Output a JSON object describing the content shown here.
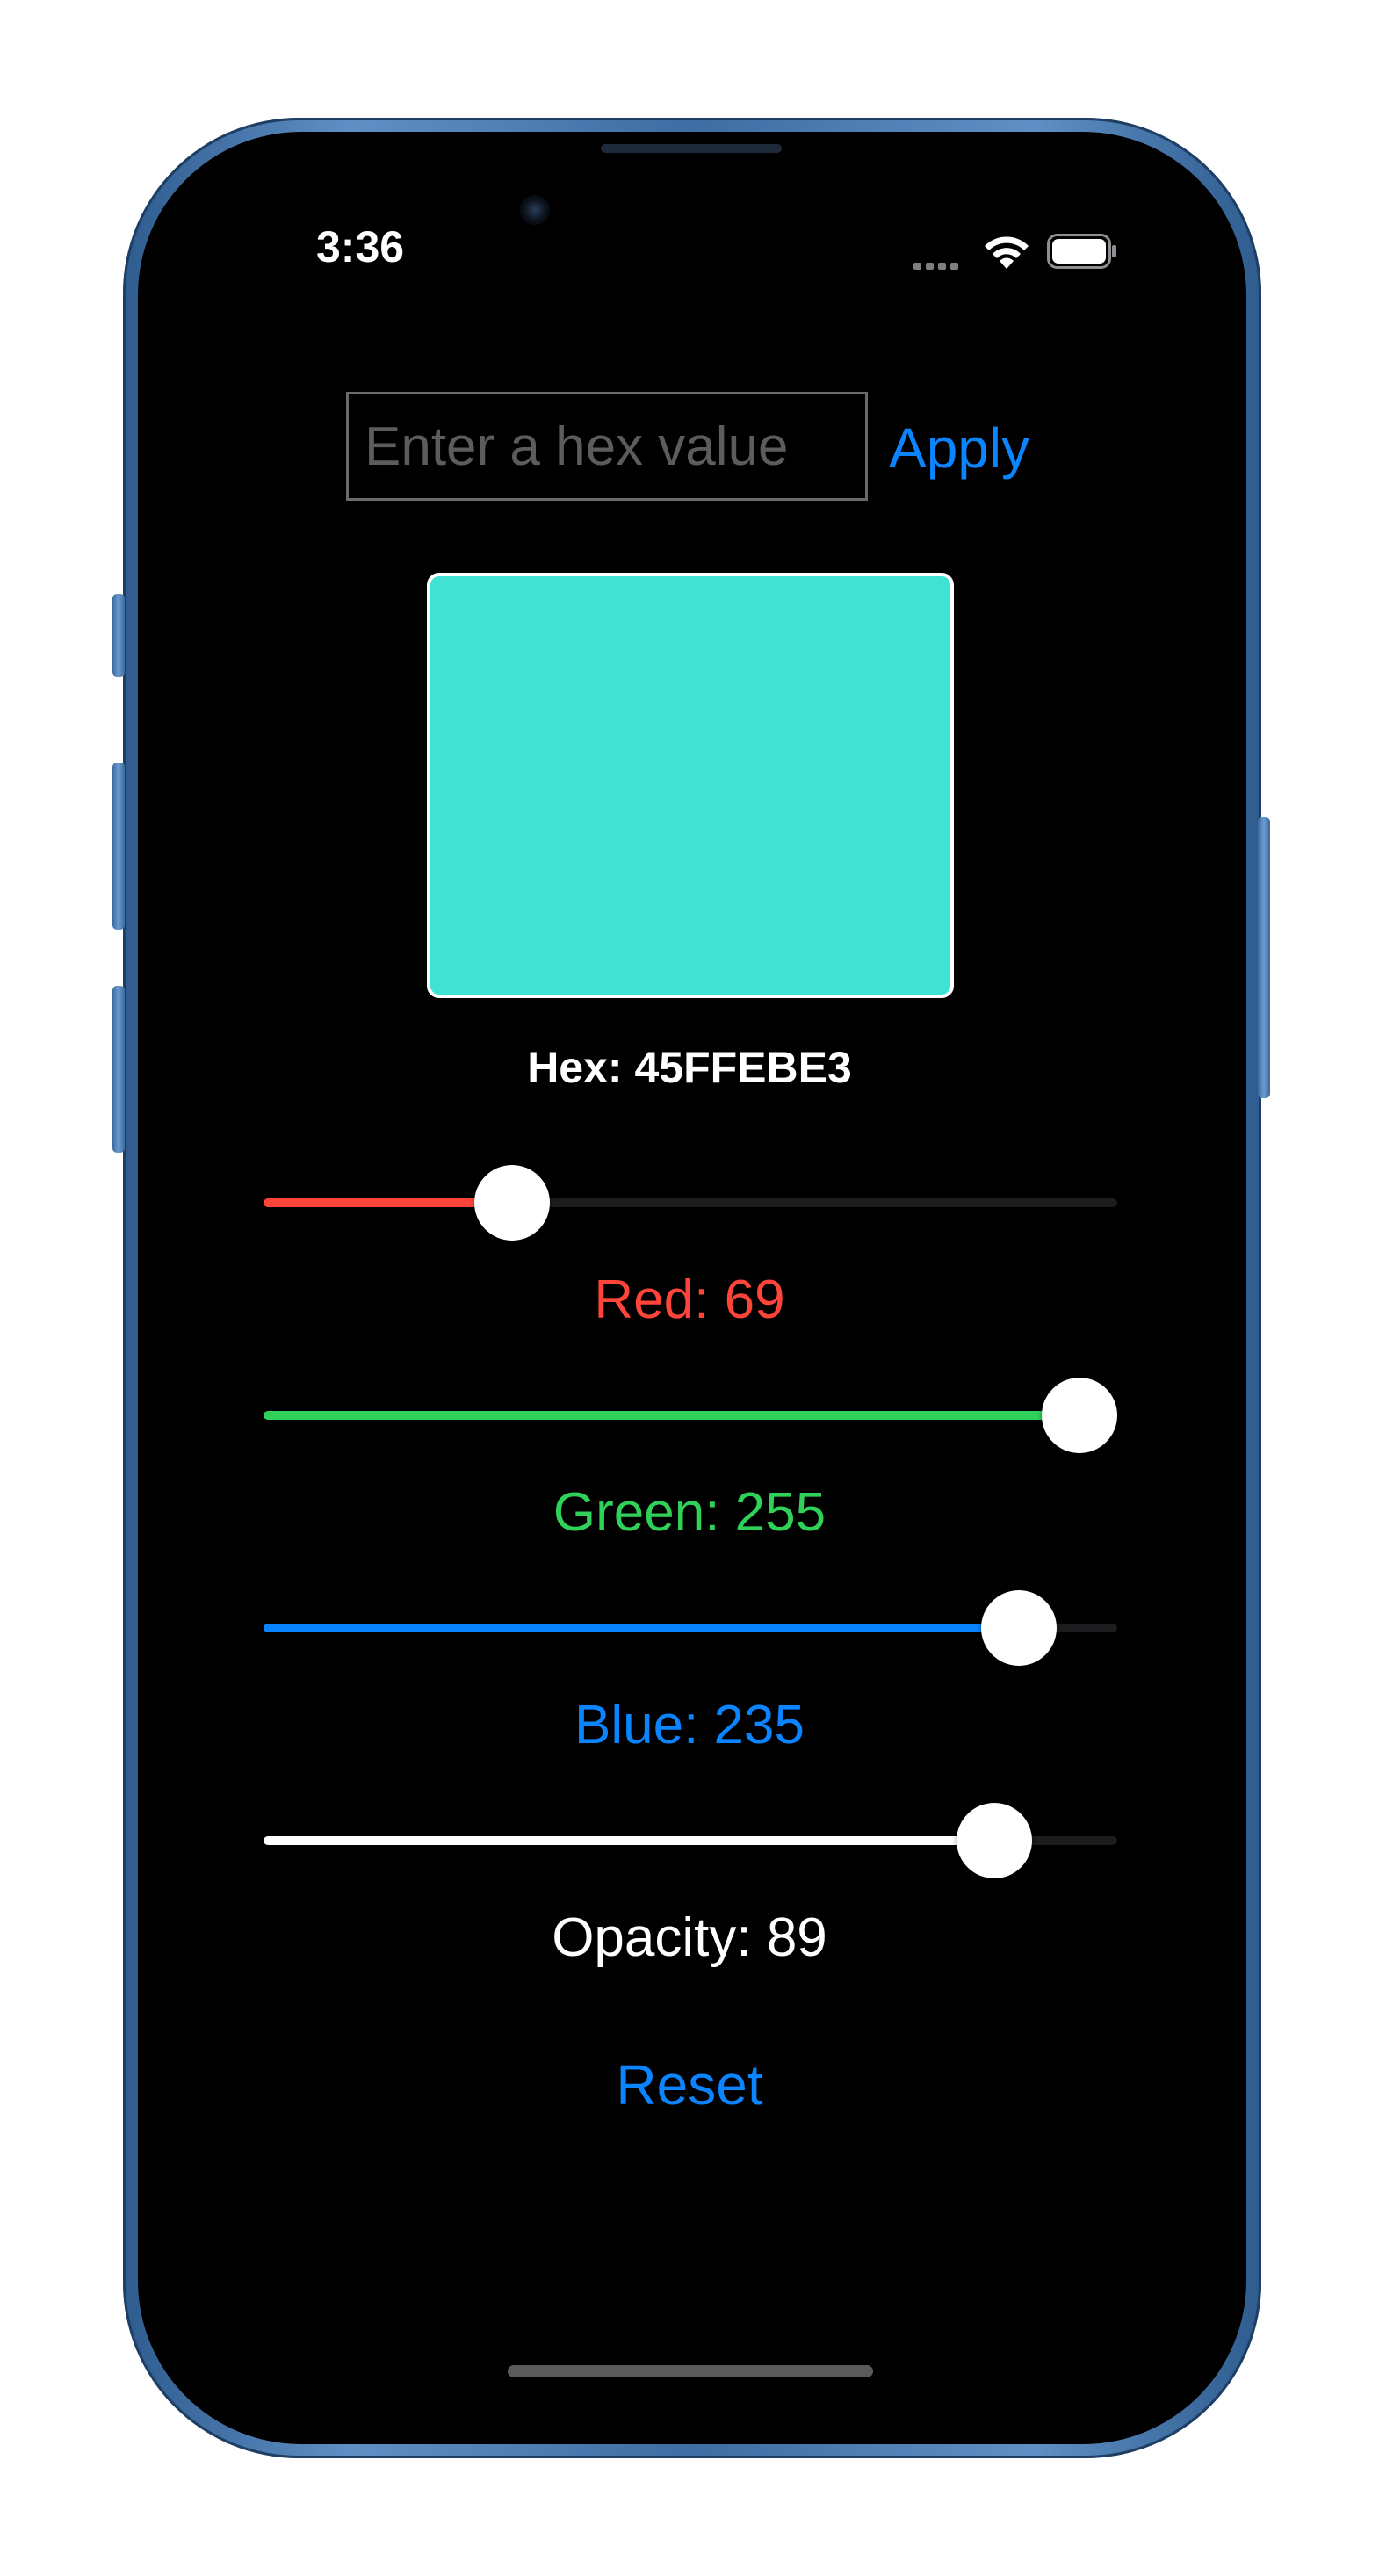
{
  "status_bar": {
    "time": "3:36",
    "wifi_icon": "wifi-icon",
    "battery_icon": "battery-icon",
    "signal_icon": "cellular-signal-icon"
  },
  "hex_input": {
    "placeholder": "Enter a hex value",
    "value": ""
  },
  "apply_label": "Apply",
  "preview": {
    "color": "#40E3D3"
  },
  "hex_label": "Hex: 45FFEBE3",
  "sliders": {
    "red": {
      "label": "Red: 69",
      "value": 69,
      "max": 255,
      "color": "#ff453a"
    },
    "green": {
      "label": "Green: 255",
      "value": 255,
      "max": 255,
      "color": "#30d158"
    },
    "blue": {
      "label": "Blue: 235",
      "value": 235,
      "max": 255,
      "color": "#0a84ff"
    },
    "opacity": {
      "label": "Opacity: 89",
      "value": 89,
      "max": 100,
      "color": "#ffffff"
    }
  },
  "reset_label": "Reset",
  "colors": {
    "accent": "#0a84ff",
    "background": "#000000"
  }
}
